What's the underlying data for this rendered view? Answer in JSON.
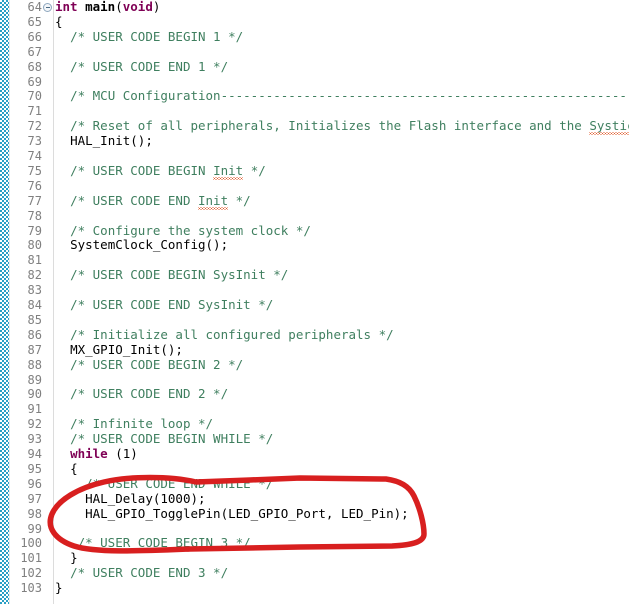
{
  "editor": {
    "app_kind": "code-editor",
    "language": "c",
    "first_line": 64,
    "last_line": 103,
    "colors": {
      "background": "#ffffff",
      "comment": "#3f7f5f",
      "keyword": "#7f0055",
      "code": "#000000",
      "line_number": "#808080",
      "gutter_border": "#dcdcdc",
      "annotation_ruler": "#2a9fc4",
      "spellcheck_squiggle": "#e05a2a",
      "annotation_ink": "#d81f1f"
    },
    "fold_marker": {
      "name": "collapse-fold-marker",
      "line": 64,
      "state": "expanded"
    },
    "annotation": {
      "name": "red-ellipse-annotation",
      "shape": "hand-drawn-ellipse",
      "color": "#d81f1f",
      "encircles_lines": [
        96,
        97,
        98,
        99
      ]
    },
    "spellcheck_words": [
      "Systick",
      "Init",
      "Init"
    ],
    "lines": [
      {
        "n": 64,
        "indent": 0,
        "tokens": [
          {
            "t": "keyword",
            "s": "int"
          },
          {
            "t": "plain",
            "s": " "
          },
          {
            "t": "fn",
            "s": "main"
          },
          {
            "t": "plain",
            "s": "("
          },
          {
            "t": "keyword",
            "s": "void"
          },
          {
            "t": "plain",
            "s": ")"
          }
        ]
      },
      {
        "n": 65,
        "indent": 0,
        "tokens": [
          {
            "t": "plain",
            "s": "{"
          }
        ]
      },
      {
        "n": 66,
        "indent": 2,
        "tokens": [
          {
            "t": "comment",
            "s": "/* USER CODE BEGIN 1 */"
          }
        ]
      },
      {
        "n": 67,
        "indent": 0,
        "tokens": []
      },
      {
        "n": 68,
        "indent": 2,
        "tokens": [
          {
            "t": "comment",
            "s": "/* USER CODE END 1 */"
          }
        ]
      },
      {
        "n": 69,
        "indent": 0,
        "tokens": []
      },
      {
        "n": 70,
        "indent": 2,
        "tokens": [
          {
            "t": "comment",
            "s": "/* MCU Configuration--------------------------------------------------------*/"
          }
        ]
      },
      {
        "n": 71,
        "indent": 0,
        "tokens": []
      },
      {
        "n": 72,
        "indent": 2,
        "tokens": [
          {
            "t": "comment",
            "s": "/* Reset of all peripherals, Initializes the Flash interface and the "
          },
          {
            "t": "comment",
            "s": "Systick",
            "squiggle": true
          },
          {
            "t": "comment",
            "s": ". */"
          }
        ]
      },
      {
        "n": 73,
        "indent": 2,
        "tokens": [
          {
            "t": "plain",
            "s": "HAL_Init();"
          }
        ]
      },
      {
        "n": 74,
        "indent": 0,
        "tokens": []
      },
      {
        "n": 75,
        "indent": 2,
        "tokens": [
          {
            "t": "comment",
            "s": "/* USER CODE BEGIN "
          },
          {
            "t": "comment",
            "s": "Init",
            "squiggle": true
          },
          {
            "t": "comment",
            "s": " */"
          }
        ]
      },
      {
        "n": 76,
        "indent": 0,
        "tokens": []
      },
      {
        "n": 77,
        "indent": 2,
        "tokens": [
          {
            "t": "comment",
            "s": "/* USER CODE END "
          },
          {
            "t": "comment",
            "s": "Init",
            "squiggle": true
          },
          {
            "t": "comment",
            "s": " */"
          }
        ]
      },
      {
        "n": 78,
        "indent": 0,
        "tokens": []
      },
      {
        "n": 79,
        "indent": 2,
        "tokens": [
          {
            "t": "comment",
            "s": "/* Configure the system clock */"
          }
        ]
      },
      {
        "n": 80,
        "indent": 2,
        "tokens": [
          {
            "t": "plain",
            "s": "SystemClock_Config();"
          }
        ]
      },
      {
        "n": 81,
        "indent": 0,
        "tokens": []
      },
      {
        "n": 82,
        "indent": 2,
        "tokens": [
          {
            "t": "comment",
            "s": "/* USER CODE BEGIN SysInit */"
          }
        ]
      },
      {
        "n": 83,
        "indent": 0,
        "tokens": []
      },
      {
        "n": 84,
        "indent": 2,
        "tokens": [
          {
            "t": "comment",
            "s": "/* USER CODE END SysInit */"
          }
        ]
      },
      {
        "n": 85,
        "indent": 0,
        "tokens": []
      },
      {
        "n": 86,
        "indent": 2,
        "tokens": [
          {
            "t": "comment",
            "s": "/* Initialize all configured peripherals */"
          }
        ]
      },
      {
        "n": 87,
        "indent": 2,
        "tokens": [
          {
            "t": "plain",
            "s": "MX_GPIO_Init();"
          }
        ]
      },
      {
        "n": 88,
        "indent": 2,
        "tokens": [
          {
            "t": "comment",
            "s": "/* USER CODE BEGIN 2 */"
          }
        ]
      },
      {
        "n": 89,
        "indent": 0,
        "tokens": []
      },
      {
        "n": 90,
        "indent": 2,
        "tokens": [
          {
            "t": "comment",
            "s": "/* USER CODE END 2 */"
          }
        ]
      },
      {
        "n": 91,
        "indent": 0,
        "tokens": []
      },
      {
        "n": 92,
        "indent": 2,
        "tokens": [
          {
            "t": "comment",
            "s": "/* Infinite loop */"
          }
        ]
      },
      {
        "n": 93,
        "indent": 2,
        "tokens": [
          {
            "t": "comment",
            "s": "/* USER CODE BEGIN WHILE */"
          }
        ]
      },
      {
        "n": 94,
        "indent": 2,
        "tokens": [
          {
            "t": "keyword",
            "s": "while"
          },
          {
            "t": "plain",
            "s": " (1)"
          }
        ]
      },
      {
        "n": 95,
        "indent": 2,
        "tokens": [
          {
            "t": "plain",
            "s": "{"
          }
        ]
      },
      {
        "n": 96,
        "indent": 4,
        "tokens": [
          {
            "t": "comment",
            "s": "/* USER CODE END WHILE */"
          }
        ]
      },
      {
        "n": 97,
        "indent": 4,
        "tokens": [
          {
            "t": "plain",
            "s": "HAL_Delay(1000);"
          }
        ]
      },
      {
        "n": 98,
        "indent": 4,
        "tokens": [
          {
            "t": "plain",
            "s": "HAL_GPIO_TogglePin(LED_GPIO_Port, LED_Pin);"
          }
        ]
      },
      {
        "n": 99,
        "indent": 0,
        "tokens": []
      },
      {
        "n": 100,
        "indent": 3,
        "tokens": [
          {
            "t": "comment",
            "s": "/* USER CODE BEGIN 3 */"
          }
        ]
      },
      {
        "n": 101,
        "indent": 2,
        "tokens": [
          {
            "t": "plain",
            "s": "}"
          }
        ]
      },
      {
        "n": 102,
        "indent": 2,
        "tokens": [
          {
            "t": "comment",
            "s": "/* USER CODE END 3 */"
          }
        ]
      },
      {
        "n": 103,
        "indent": 0,
        "tokens": [
          {
            "t": "plain",
            "s": "}"
          }
        ]
      }
    ]
  }
}
